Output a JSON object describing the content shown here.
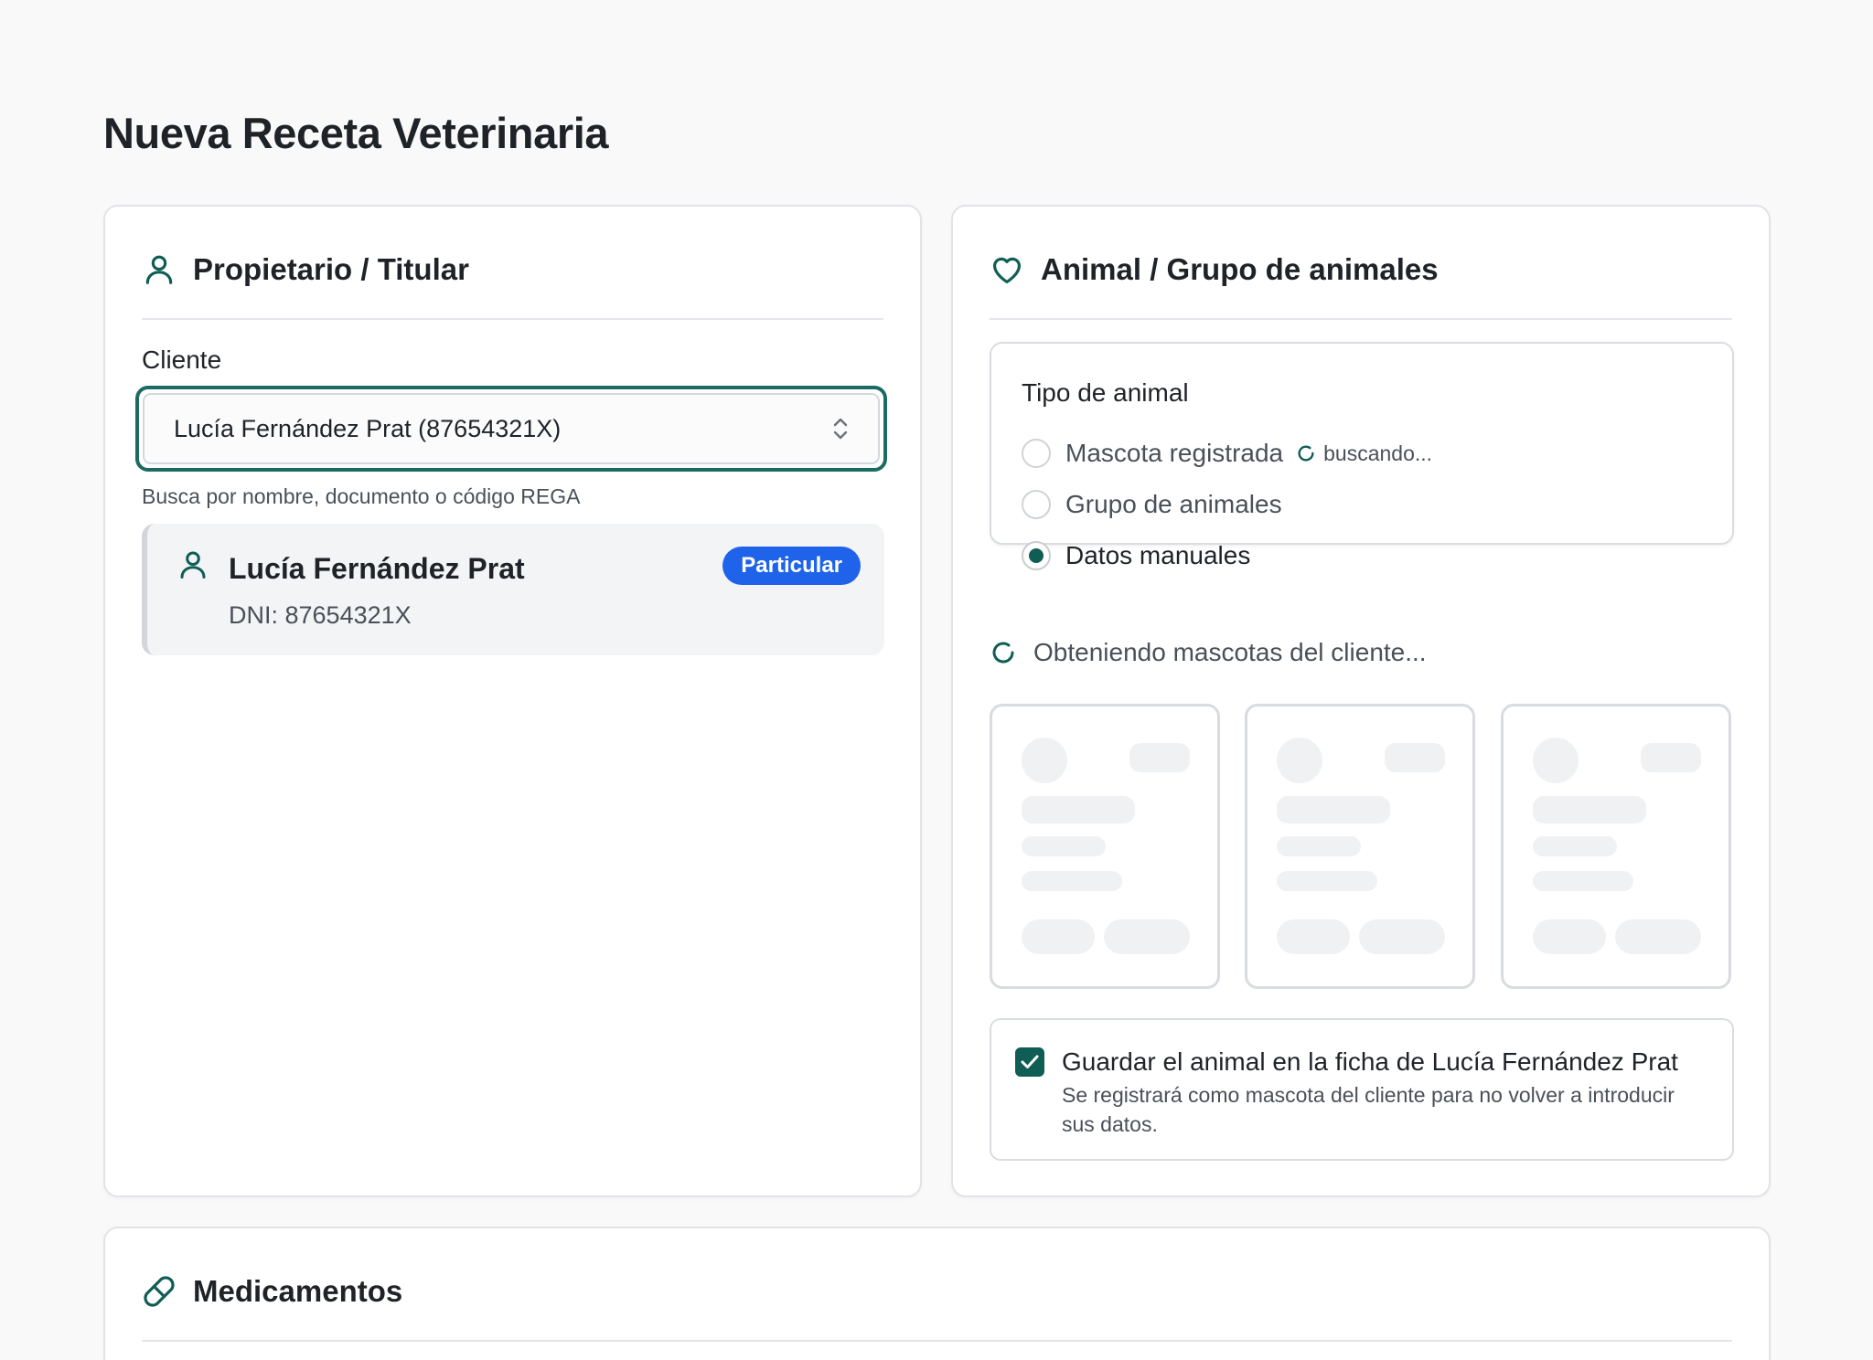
{
  "page": {
    "title": "Nueva Receta Veterinaria"
  },
  "colors": {
    "accent": "#0f5d55",
    "badge": "#1e63e9",
    "background": "#f9f9f9"
  },
  "owner": {
    "title": "Propietario / Titular",
    "icon": "user-icon",
    "client_label": "Cliente",
    "client_value": "Lucía Fernández Prat (87654321X)",
    "hint": "Busca por nombre, documento o código REGA",
    "selected_client": {
      "name": "Lucía Fernández Prat",
      "document": "DNI: 87654321X",
      "badge": "Particular"
    }
  },
  "animal": {
    "title": "Animal / Grupo de animales",
    "icon": "heart-icon",
    "type_label": "Tipo de animal",
    "options": [
      {
        "label": "Mascota registrada",
        "checked": false
      },
      {
        "label": "Grupo de animales",
        "checked": false
      },
      {
        "label": "Datos manuales",
        "checked": true
      }
    ],
    "searching_text": "buscando...",
    "loading_text": "Obteniendo mascotas del cliente...",
    "save": {
      "checked": true,
      "title": "Guardar el animal en la ficha de Lucía Fernández Prat",
      "description": "Se registrará como mascota del cliente para no volver a introducir sus datos."
    }
  },
  "medications": {
    "title": "Medicamentos",
    "icon": "pill-icon"
  }
}
